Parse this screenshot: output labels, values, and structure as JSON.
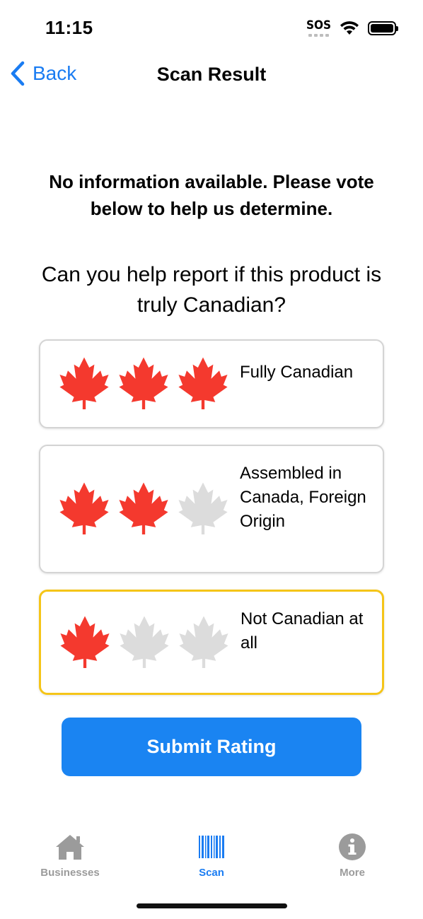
{
  "status_bar": {
    "time": "11:15",
    "sos": "SOS"
  },
  "nav": {
    "back_label": "Back",
    "title": "Scan Result"
  },
  "info_message": "No information available. Please vote below to help us determine.",
  "question": "Can you help report if this product is truly Canadian?",
  "options": [
    {
      "label": "Fully Canadian",
      "filled_leaves": 3,
      "total_leaves": 3,
      "selected": false
    },
    {
      "label": "Assembled in Canada, Foreign Origin",
      "filled_leaves": 2,
      "total_leaves": 3,
      "selected": false
    },
    {
      "label": "Not Canadian at all",
      "filled_leaves": 1,
      "total_leaves": 3,
      "selected": true
    }
  ],
  "submit_label": "Submit Rating",
  "tabs": [
    {
      "label": "Businesses",
      "icon": "house-icon",
      "active": false
    },
    {
      "label": "Scan",
      "icon": "barcode-icon",
      "active": true
    },
    {
      "label": "More",
      "icon": "info-icon",
      "active": false
    }
  ],
  "colors": {
    "accent": "#1a7cf2",
    "button": "#1a84f2",
    "leaf_filled": "#f4392e",
    "leaf_empty": "#dcdcdc",
    "selected_border": "#f5c518",
    "tab_inactive": "#9b9b9b"
  }
}
